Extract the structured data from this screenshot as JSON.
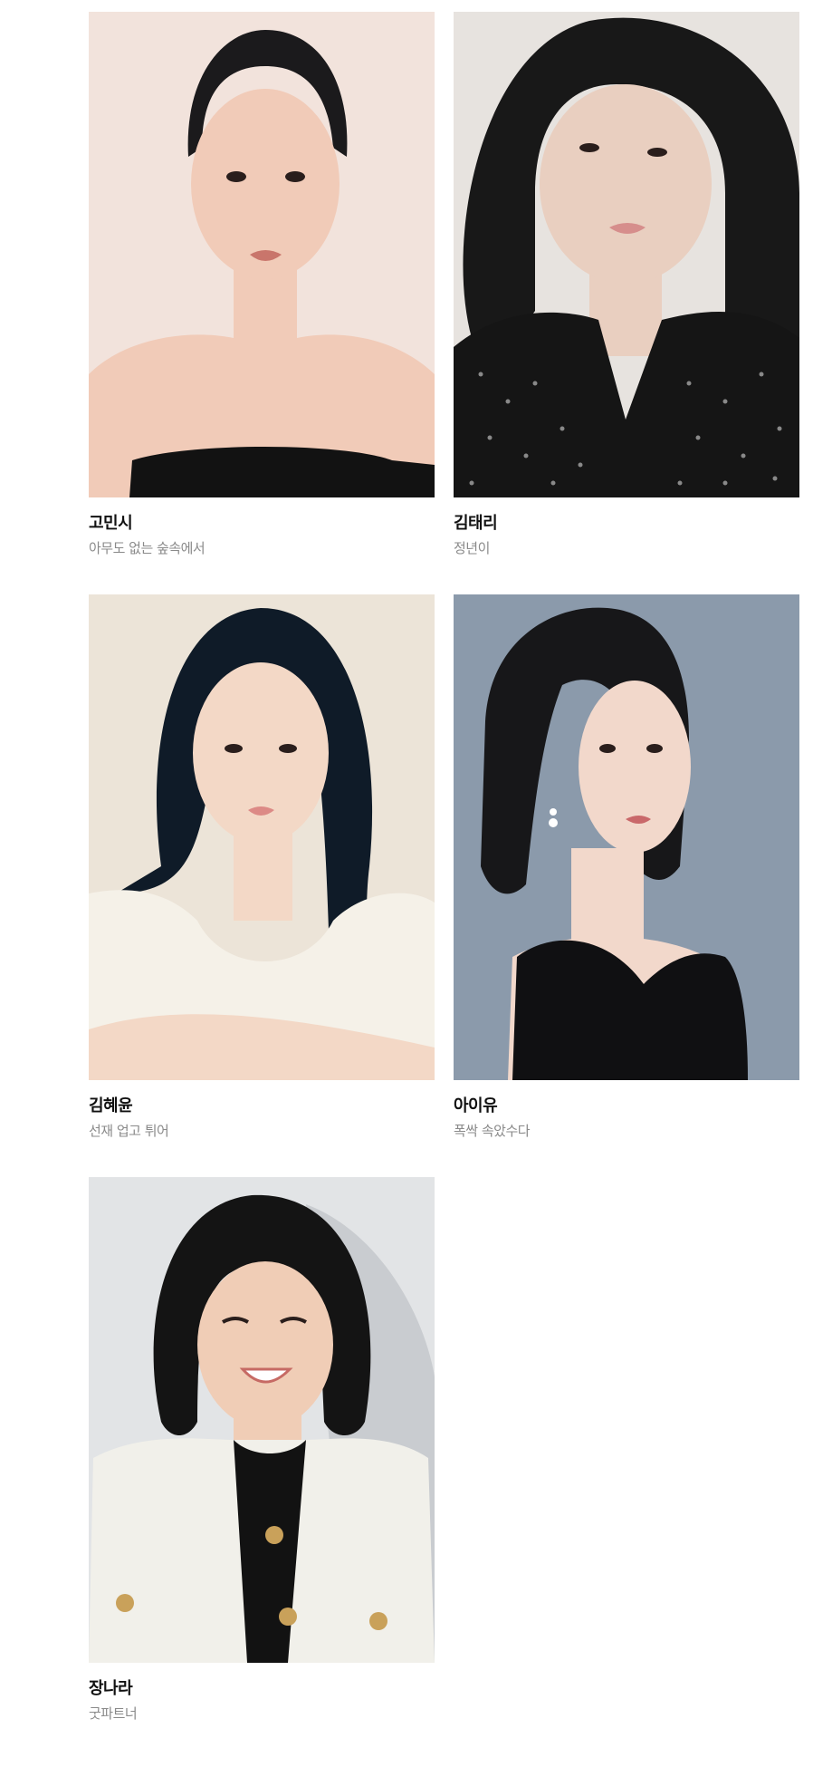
{
  "cast": [
    {
      "name": "고민시",
      "work": "아무도 없는 숲속에서",
      "colors": {
        "bg": "#f2e3dc",
        "hair": "#1b1a1c",
        "skin": "#f1cbb8",
        "clothing": "#121212",
        "lip": "#c9756b"
      }
    },
    {
      "name": "김태리",
      "work": "정년이",
      "colors": {
        "bg": "#e7e3df",
        "hair": "#181818",
        "skin": "#e9cfc0",
        "clothing": "#151515",
        "lip": "#d68e8c"
      }
    },
    {
      "name": "김혜윤",
      "work": "선재 업고 튀어",
      "colors": {
        "bg": "#ece4d8",
        "hair": "#0f1b28",
        "skin": "#f3d8c6",
        "clothing": "#f5f1e8",
        "lip": "#dc8a86"
      }
    },
    {
      "name": "아이유",
      "work": "폭싹 속았수다",
      "colors": {
        "bg": "#8b9aab",
        "hair": "#171719",
        "skin": "#f2d8cb",
        "clothing": "#101012",
        "lip": "#c9686a"
      }
    },
    {
      "name": "장나라",
      "work": "굿파트너",
      "colors": {
        "bg": "#e2e4e6",
        "hair": "#141414",
        "skin": "#f0cdb6",
        "clothing": "#f1f0ea",
        "lip": "#cf7b75"
      }
    }
  ]
}
